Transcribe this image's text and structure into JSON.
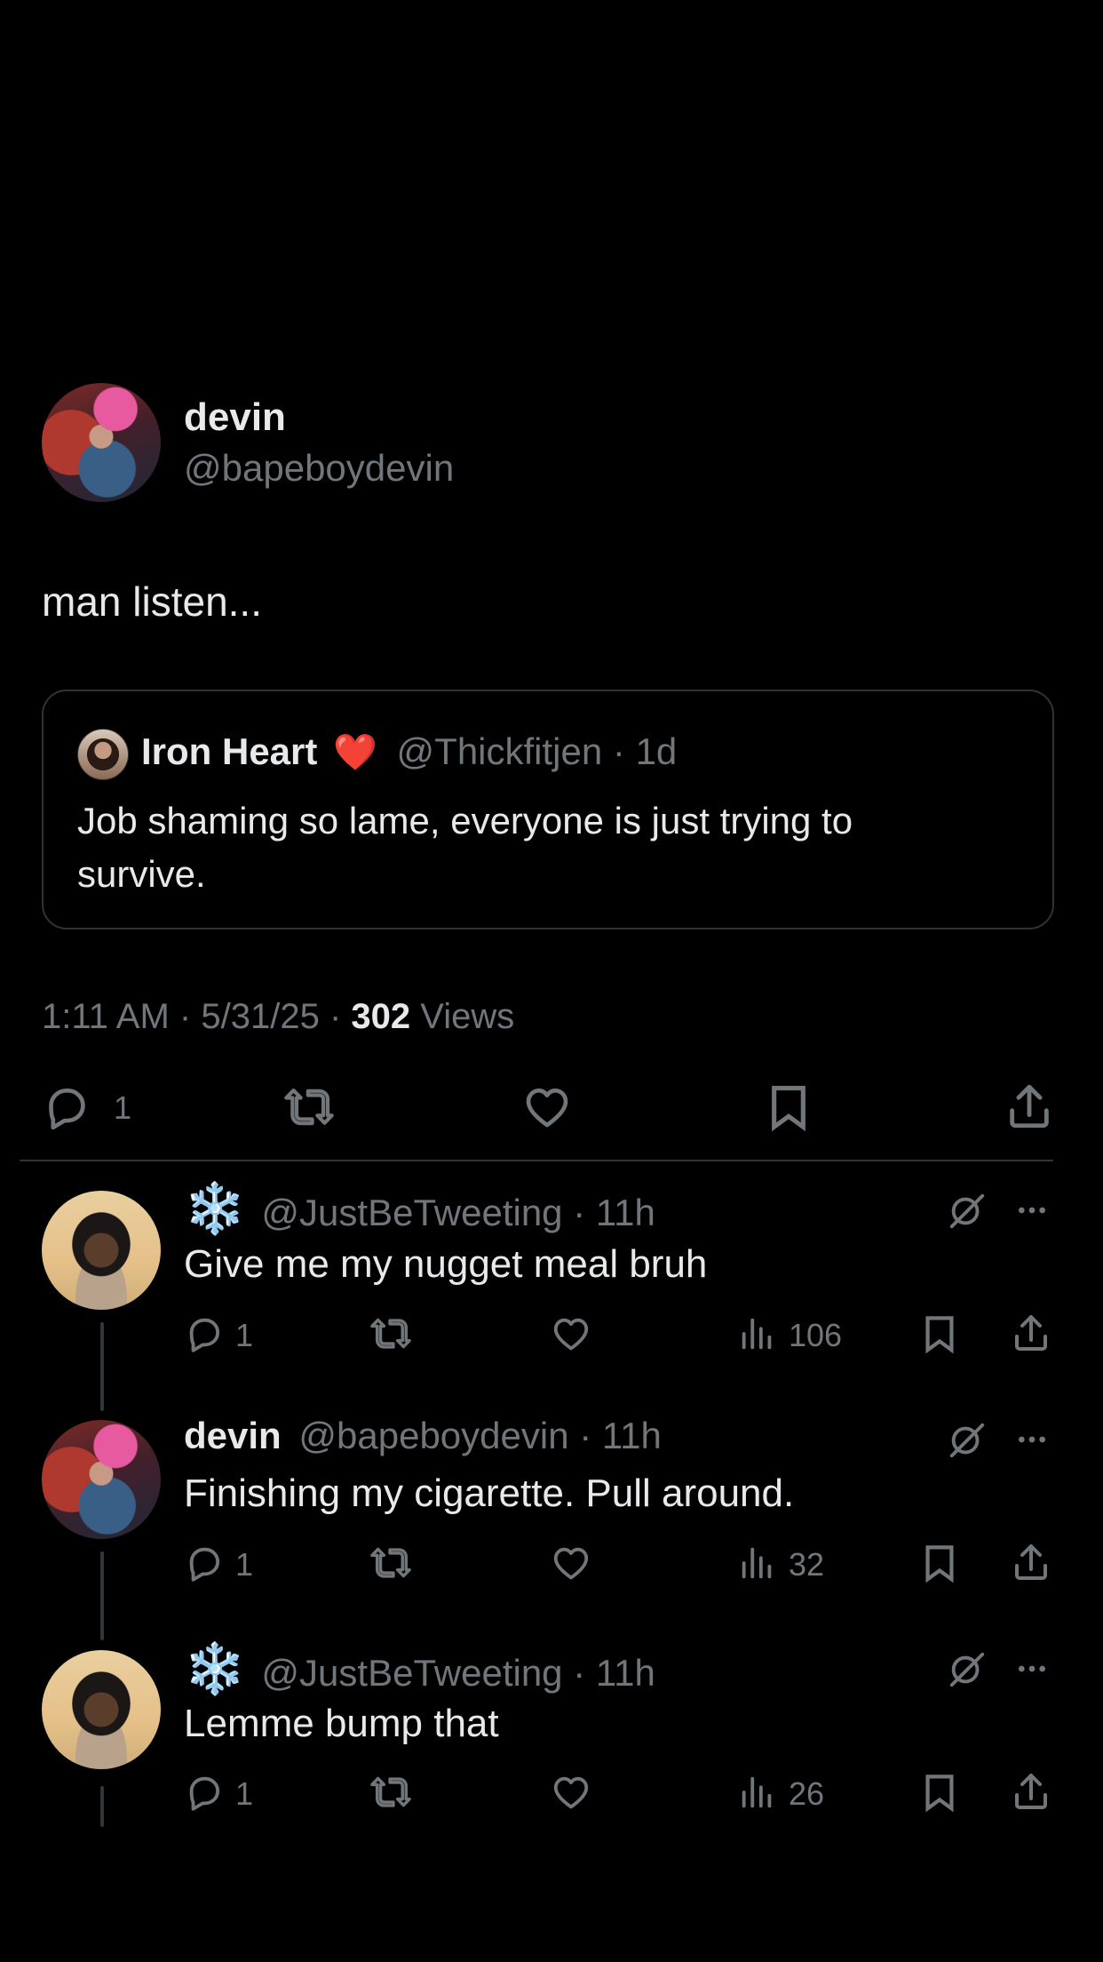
{
  "post": {
    "author_name": "devin",
    "author_handle": "@bapeboydevin",
    "text": "man listen...",
    "quote": {
      "author_name": "Iron Heart",
      "author_emoji": "❤️",
      "author_handle": "@Thickfitjen",
      "separator": "·",
      "age": "1d",
      "text_line1": "Job shaming so lame, everyone is just trying to",
      "text_line2": "survive."
    },
    "time": "1:11 AM",
    "date": "5/31/25",
    "dot": "·",
    "views_count": "302",
    "views_label": "Views",
    "actions": {
      "reply_count": "1"
    }
  },
  "replies": [
    {
      "emoji": "❄️",
      "author_name": "",
      "author_handle": "@JustBeTweeting",
      "separator": "·",
      "age": "11h",
      "text": "Give me my nugget meal bruh",
      "reply_count": "1",
      "views": "106"
    },
    {
      "emoji": "",
      "author_name": "devin",
      "author_handle": "@bapeboydevin",
      "separator": "·",
      "age": "11h",
      "text": "Finishing my cigarette. Pull around.",
      "reply_count": "1",
      "views": "32"
    },
    {
      "emoji": "❄️",
      "author_name": "",
      "author_handle": "@JustBeTweeting",
      "separator": "·",
      "age": "11h",
      "text": "Lemme bump that",
      "reply_count": "1",
      "views": "26"
    }
  ],
  "icons": {
    "reply": "reply-icon",
    "repost": "repost-icon",
    "like": "like-icon",
    "bookmark": "bookmark-icon",
    "share": "share-icon",
    "views": "views-icon",
    "grok": "grok-icon",
    "more": "more-icon"
  },
  "colors": {
    "background": "#000000",
    "text": "#e7e9ea",
    "muted": "#71767b",
    "border": "#2f3336",
    "heart": "#f91880"
  }
}
